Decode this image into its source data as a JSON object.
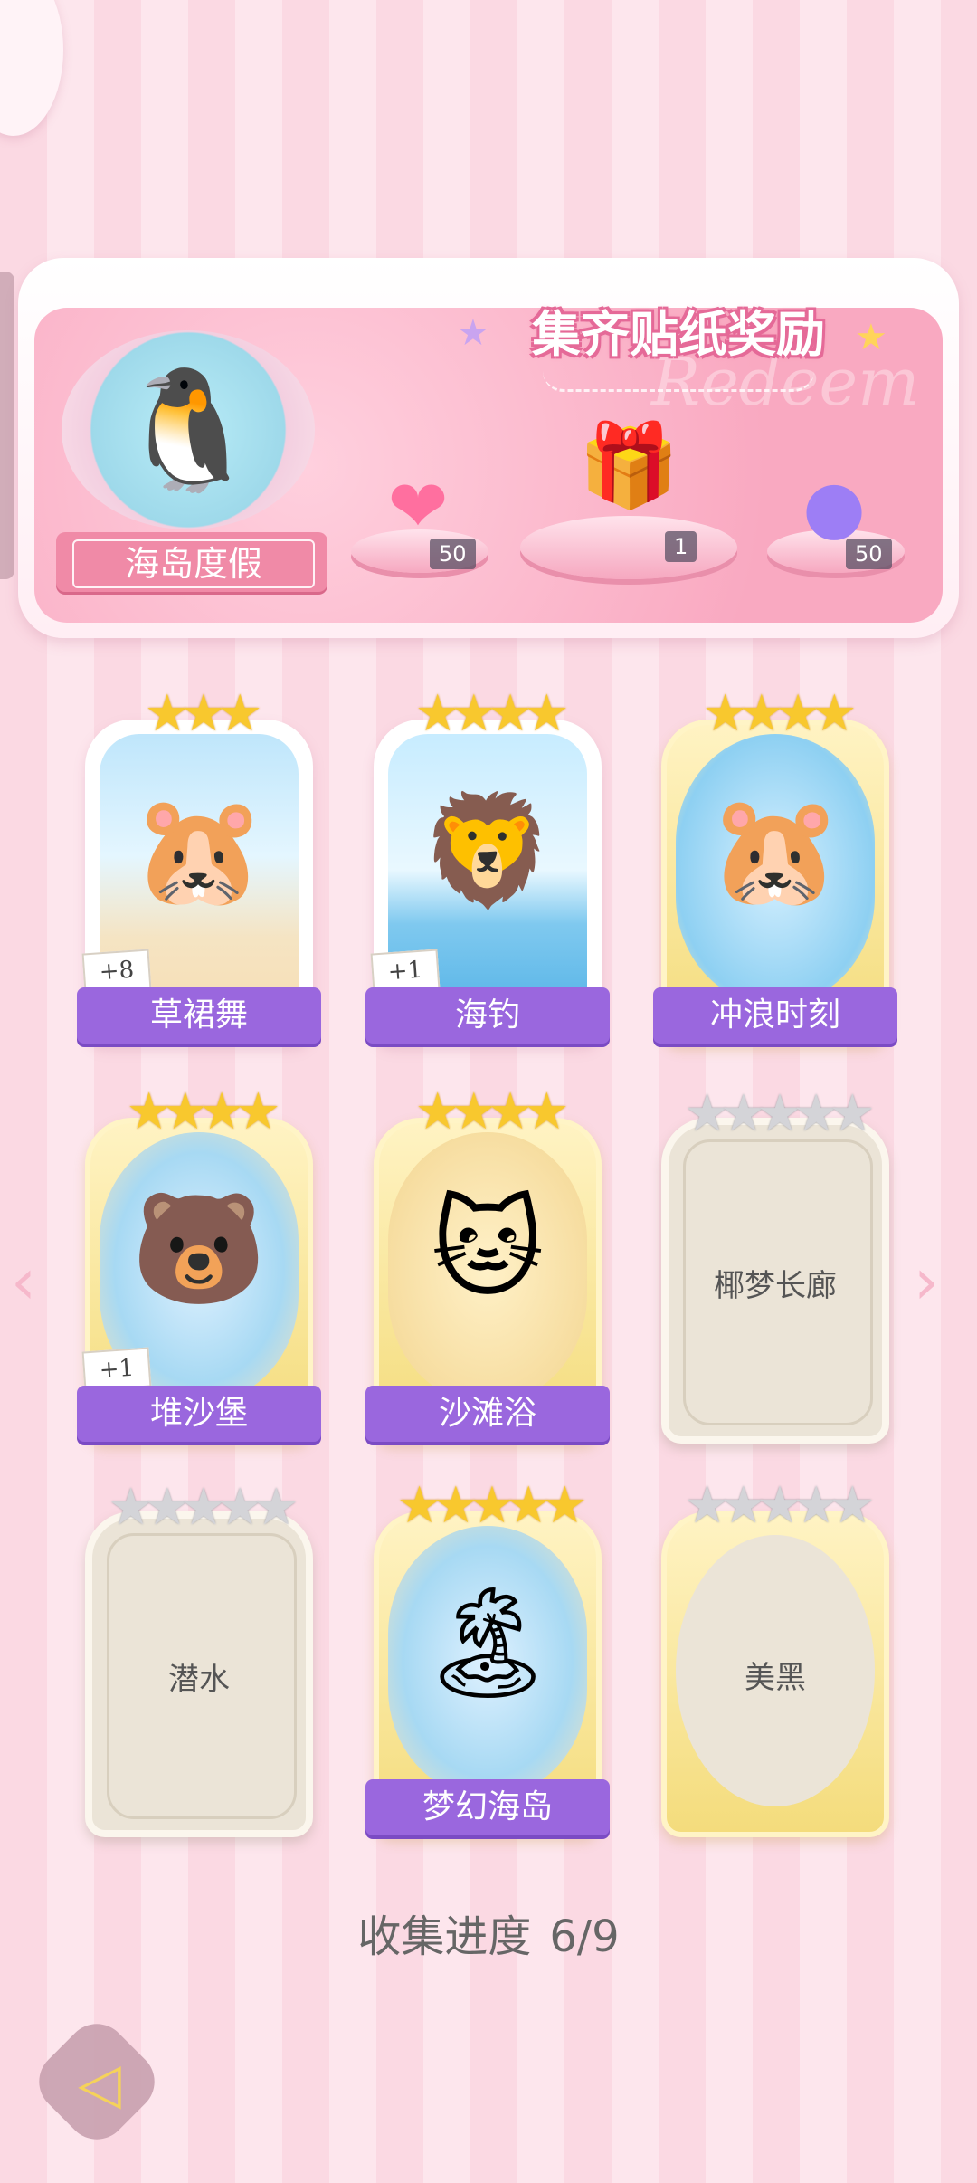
{
  "header": {
    "title": "集齐贴纸奖励",
    "watermark": "Redeem",
    "theme_label": "海岛度假",
    "rewards": [
      {
        "icon": "pink-heart-gem-icon",
        "count": "50"
      },
      {
        "icon": "gift-box-icon",
        "count": "1"
      },
      {
        "icon": "purple-lightning-orb-icon",
        "count": "50"
      }
    ]
  },
  "cards": [
    {
      "name": "草裙舞",
      "stars": 3,
      "collected": true,
      "extra": "+8",
      "art": "capybara-hula-icon",
      "glyph": "🐹"
    },
    {
      "name": "海钓",
      "stars": 4,
      "collected": true,
      "extra": "+1",
      "art": "lion-fishing-icon",
      "glyph": "🦁"
    },
    {
      "name": "冲浪时刻",
      "stars": 4,
      "collected": true,
      "extra": "",
      "art": "hamster-surfing-icon",
      "glyph": "🐹"
    },
    {
      "name": "堆沙堡",
      "stars": 4,
      "collected": true,
      "extra": "+1",
      "art": "bear-sandcastle-icon",
      "glyph": "🐻"
    },
    {
      "name": "沙滩浴",
      "stars": 4,
      "collected": true,
      "extra": "",
      "art": "cat-sand-bath-icon",
      "glyph": "🐱"
    },
    {
      "name": "椰梦长廊",
      "stars": 5,
      "collected": false,
      "extra": "",
      "art": "",
      "glyph": ""
    },
    {
      "name": "潜水",
      "stars": 5,
      "collected": false,
      "extra": "",
      "art": "",
      "glyph": ""
    },
    {
      "name": "梦幻海岛",
      "stars": 5,
      "collected": true,
      "extra": "",
      "art": "beach-hut-island-icon",
      "glyph": "🏝"
    },
    {
      "name": "美黑",
      "stars": 5,
      "collected": false,
      "extra": "",
      "art": "",
      "glyph": ""
    }
  ],
  "progress": {
    "label": "收集进度",
    "value": "6/9"
  },
  "icons": {
    "fan": "pinwheel-fan-icon",
    "prev": "chevron-left-icon",
    "next": "chevron-right-icon",
    "back": "back-arrow-icon"
  },
  "colors": {
    "name_bar": "#9a67de",
    "banner_pink": "#f9a9c1",
    "star_gold": "#f8c82e"
  }
}
